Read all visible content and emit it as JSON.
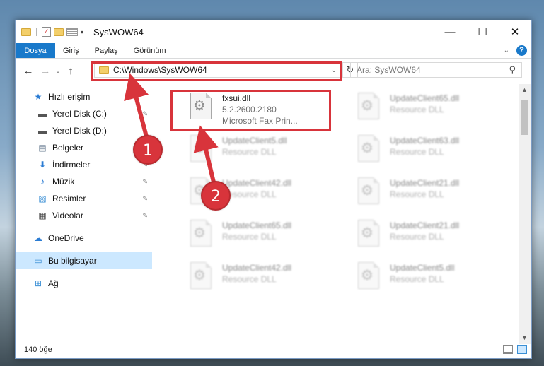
{
  "window": {
    "title": "SysWOW64"
  },
  "controls": {
    "minimize": "—",
    "maximize": "☐",
    "close": "✕"
  },
  "ribbon": {
    "tabs": [
      "Dosya",
      "Giriş",
      "Paylaş",
      "Görünüm"
    ],
    "collapse_glyph": "⌄",
    "help_glyph": "?"
  },
  "navigation": {
    "back": "←",
    "forward": "→",
    "recent": "⌄",
    "up": "↑",
    "address": "C:\\Windows\\SysWOW64",
    "address_caret": "⌄",
    "refresh": "↻",
    "search_placeholder": "Ara: SysWOW64",
    "search_glyph": "⚲"
  },
  "sidebar": {
    "items": [
      {
        "label": "Hızlı erişim",
        "icon": "star-icon",
        "glyph": "★",
        "color": "#2b7cd3",
        "pinned": false
      },
      {
        "label": "Yerel Disk (C:)",
        "icon": "drive-icon",
        "glyph": "▬",
        "color": "#555555",
        "pinned": true
      },
      {
        "label": "Yerel Disk (D:)",
        "icon": "drive-icon",
        "glyph": "▬",
        "color": "#555555",
        "pinned": true
      },
      {
        "label": "Belgeler",
        "icon": "documents-icon",
        "glyph": "▤",
        "color": "#6a7d92",
        "pinned": true
      },
      {
        "label": "İndirmeler",
        "icon": "download-icon",
        "glyph": "⬇",
        "color": "#2b7cd3",
        "pinned": true
      },
      {
        "label": "Müzik",
        "icon": "music-icon",
        "glyph": "♪",
        "color": "#2b7cd3",
        "pinned": true
      },
      {
        "label": "Resimler",
        "icon": "pictures-icon",
        "glyph": "▨",
        "color": "#3a8fd5",
        "pinned": true
      },
      {
        "label": "Videolar",
        "icon": "videos-icon",
        "glyph": "▦",
        "color": "#444444",
        "pinned": true
      },
      {
        "label": "OneDrive",
        "icon": "cloud-icon",
        "glyph": "☁",
        "color": "#2b7cd3",
        "pinned": false
      },
      {
        "label": "Bu bilgisayar",
        "icon": "computer-icon",
        "glyph": "▭",
        "color": "#3a8fd5",
        "pinned": false,
        "selected": true
      },
      {
        "label": "Ağ",
        "icon": "network-icon",
        "glyph": "⊞",
        "color": "#3a8fd5",
        "pinned": false
      }
    ],
    "pin_glyph": "📌"
  },
  "files": {
    "highlighted": {
      "name": "fxsui.dll",
      "version": "5.2.2600.2180",
      "description": "Microsoft  Fax Prin..."
    },
    "background": [
      {
        "name": "UpdateClient65.dll",
        "type": "Resource DLL"
      },
      {
        "name": "UpdateClient5.dll",
        "type": "Resource DLL"
      },
      {
        "name": "UpdateClient63.dll",
        "type": "Resource DLL"
      },
      {
        "name": "UpdateClient42.dll",
        "type": "Resource DLL"
      },
      {
        "name": "UpdateClient21.dll",
        "type": "Resource DLL"
      },
      {
        "name": "UpdateClient65.dll",
        "type": "Resource DLL"
      },
      {
        "name": "UpdateClient21.dll",
        "type": "Resource DLL"
      },
      {
        "name": "UpdateClient42.dll",
        "type": "Resource DLL"
      },
      {
        "name": "UpdateClient5.dll",
        "type": "Resource DLL"
      }
    ]
  },
  "status": {
    "item_count": "140 öğe"
  },
  "annotations": {
    "step1": "1",
    "step2": "2",
    "color": "#d8343b"
  }
}
